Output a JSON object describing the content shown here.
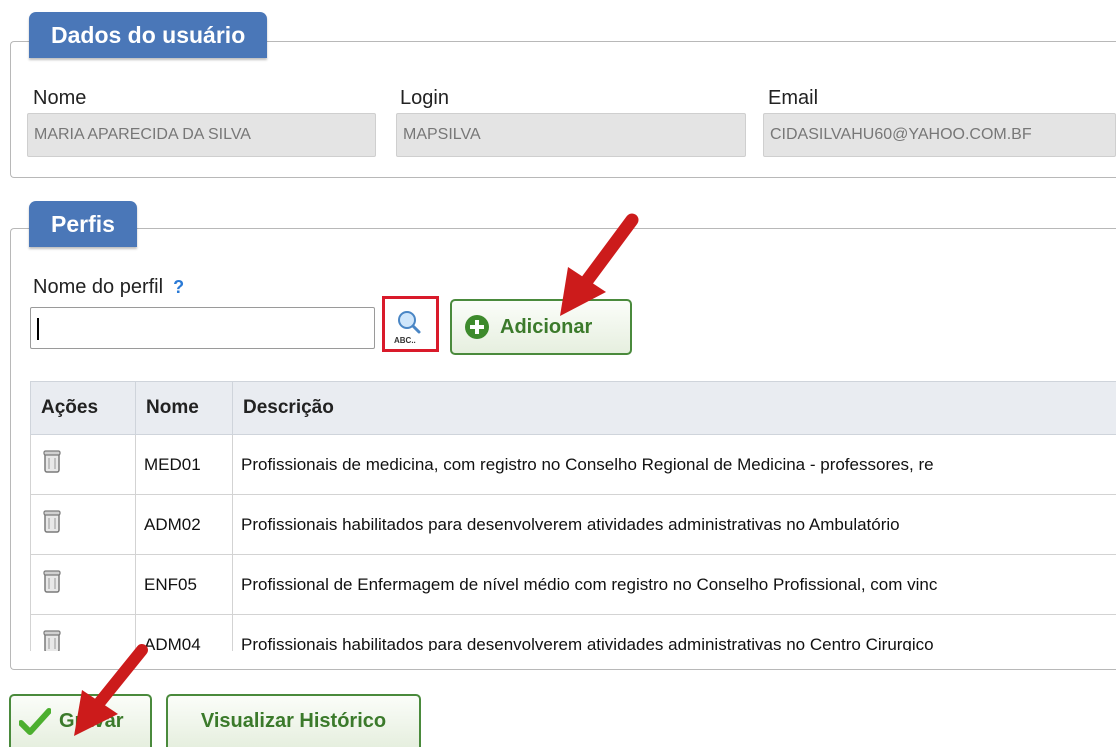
{
  "user_section": {
    "title": "Dados do usuário",
    "fields": [
      {
        "label": "Nome",
        "value": "MARIA APARECIDA DA SILVA"
      },
      {
        "label": "Login",
        "value": "MAPSILVA"
      },
      {
        "label": "Email",
        "value": "CIDASILVAHU60@YAHOO.COM.BF"
      }
    ]
  },
  "profiles_section": {
    "title": "Perfis",
    "profile_name_label": "Nome do perfil",
    "help_symbol": "?",
    "profile_name_value": "",
    "search_icon_text": "ABC..",
    "add_button_label": "Adicionar",
    "table": {
      "headers": [
        "Ações",
        "Nome",
        "Descrição"
      ],
      "rows": [
        {
          "name": "MED01",
          "description": "Profissionais de medicina, com registro no Conselho Regional de Medicina - professores, re"
        },
        {
          "name": "ADM02",
          "description": "Profissionais habilitados para desenvolverem atividades administrativas no Ambulatório"
        },
        {
          "name": "ENF05",
          "description": "Profissional de Enfermagem de nível médio com registro no Conselho Profissional, com vinc"
        },
        {
          "name": "ADM04",
          "description": "Profissionais habilitados para desenvolverem atividades administrativas no Centro Cirurgico"
        }
      ]
    }
  },
  "footer": {
    "save_label": "Gravar",
    "history_label": "Visualizar Histórico"
  },
  "colors": {
    "legend_bg": "#4a77b8",
    "button_green": "#3b7a2b",
    "highlight_red": "#d91a2a",
    "arrow_red": "#cc1b1b"
  }
}
